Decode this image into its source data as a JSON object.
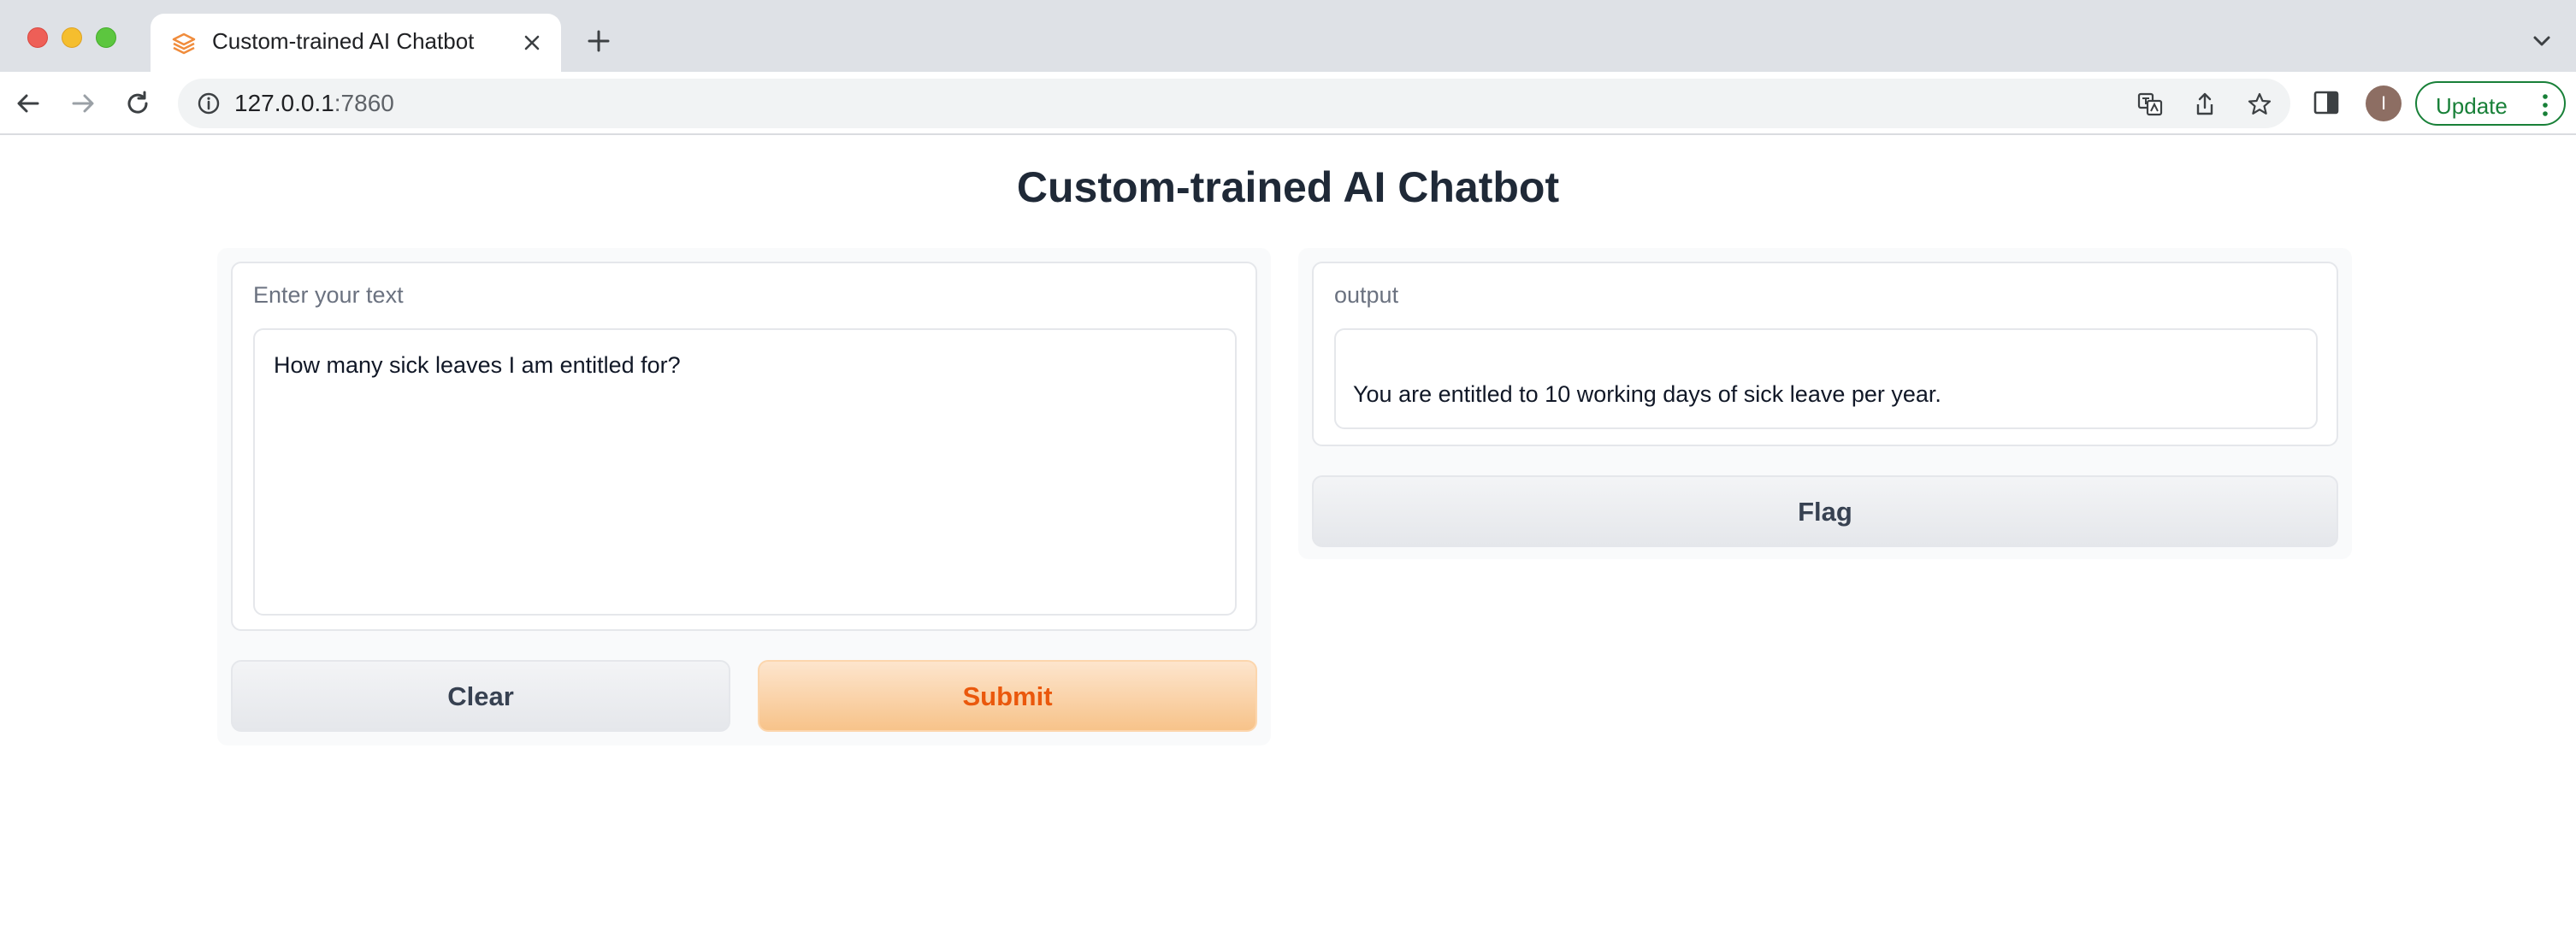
{
  "browser": {
    "tab_title": "Custom-trained AI Chatbot",
    "url_host": "127.0.0.1",
    "url_port": ":7860",
    "profile_initial": "I",
    "update_label": "Update"
  },
  "app": {
    "title": "Custom-trained AI Chatbot",
    "input": {
      "label": "Enter your text",
      "value": "How many sick leaves I am entitled for?"
    },
    "output": {
      "label": "output",
      "value": "You are entitled to 10 working days of sick leave per year."
    },
    "buttons": {
      "clear": "Clear",
      "submit": "Submit",
      "flag": "Flag"
    }
  },
  "colors": {
    "accent": "#ea580c",
    "primary_button_bg": "#f7c38a",
    "update_green": "#188038"
  },
  "icons": {
    "favicon": "gradio-logo-icon",
    "tab_close": "close-icon",
    "new_tab": "plus-icon",
    "tab_search": "chevron-down-icon",
    "back": "arrow-left-icon",
    "forward": "arrow-right-icon",
    "reload": "reload-icon",
    "site_info": "info-icon",
    "translate": "translate-icon",
    "share": "share-icon",
    "bookmark": "star-icon",
    "side_panel": "side-panel-icon",
    "menu": "kebab-menu-icon"
  }
}
